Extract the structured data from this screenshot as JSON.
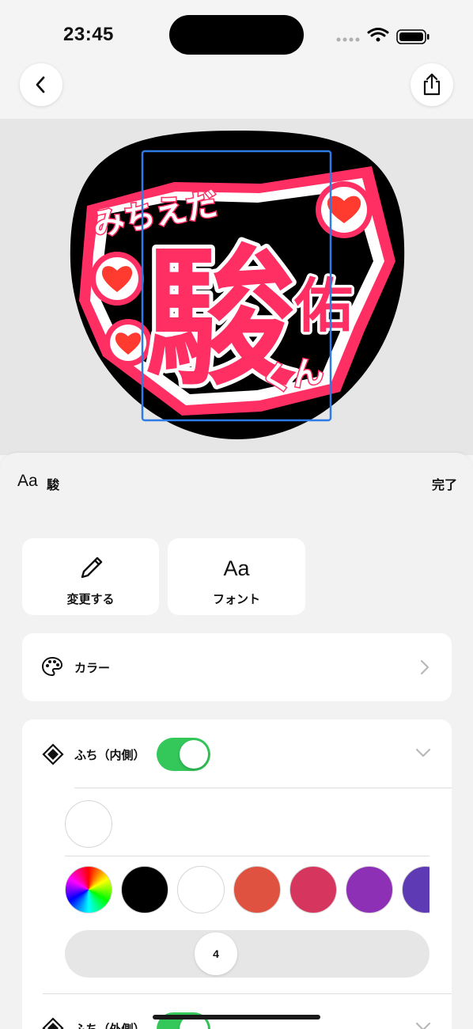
{
  "status_bar": {
    "time": "23:45"
  },
  "canvas": {
    "name_small": "みちえだ",
    "name_big": "駿",
    "name_right": "佑",
    "name_suffix": "くん",
    "colors": {
      "fill": "#ff2e63",
      "outline": "#ffffff",
      "panel": "#000000",
      "heart": "#ff3b30",
      "selection": "#2d7be5"
    }
  },
  "sheet": {
    "header": {
      "selected_aa": "Aa",
      "selected_text": "駿",
      "done_label": "完了"
    },
    "tiles": {
      "edit_label": "変更する",
      "font_icon_text": "Aa",
      "font_label": "フォント"
    },
    "color_row": {
      "label": "カラー"
    },
    "outline_inner": {
      "label": "ふち（内側）",
      "enabled": true,
      "current_color": "#ffffff",
      "palette": [
        "#000000",
        "#ffffff",
        "#e05240",
        "#d6365e",
        "#8e30b6",
        "#5e3bb4"
      ],
      "width_value": "4"
    },
    "outline_outer": {
      "label": "ふち（外側）",
      "enabled": true
    }
  }
}
